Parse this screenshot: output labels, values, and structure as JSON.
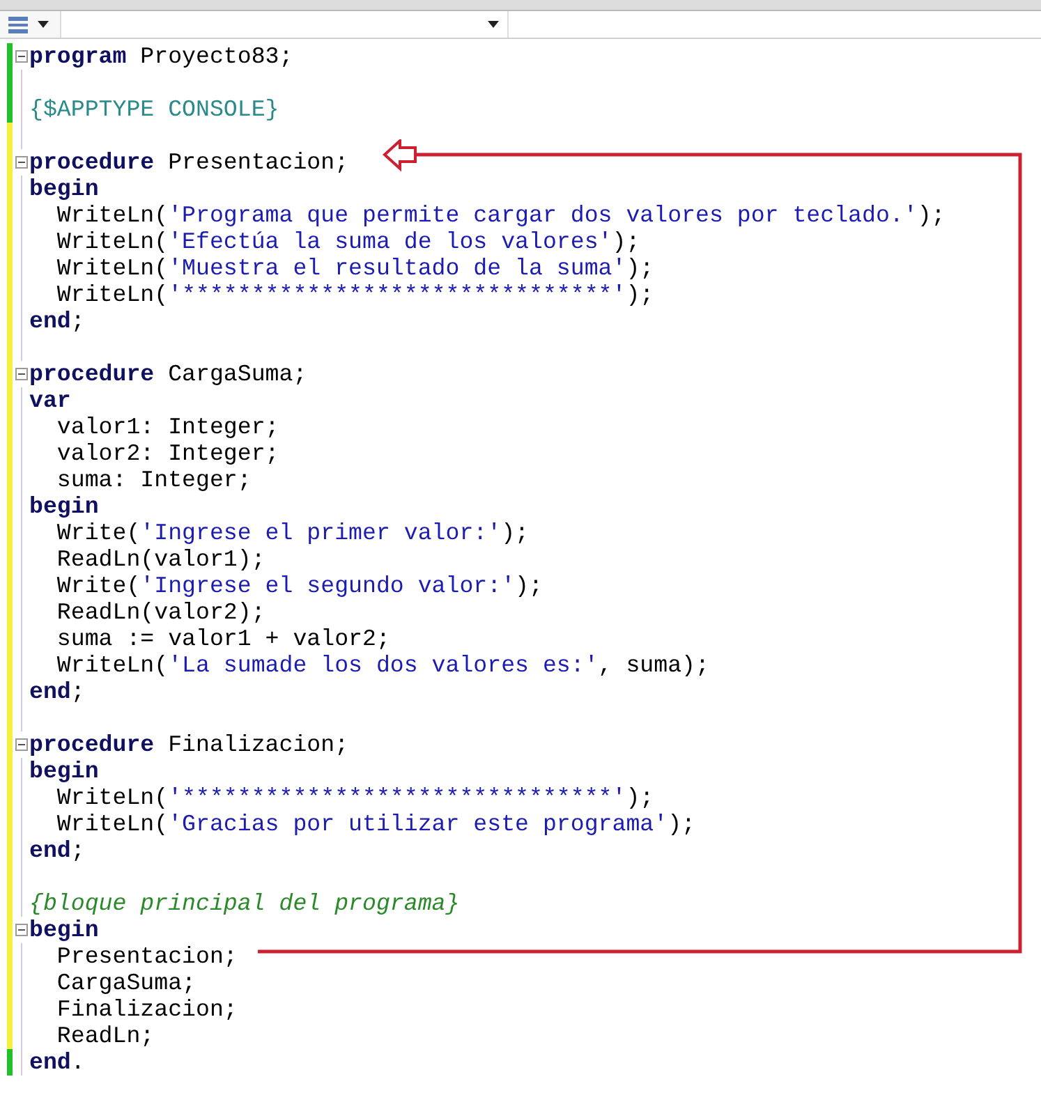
{
  "toolbar": {
    "dropdown": {
      "expanded": false
    }
  },
  "editor": {
    "lines": [
      {
        "saved": true,
        "fold": true,
        "tokens": [
          {
            "kind": "keyword",
            "text": "program"
          },
          {
            "kind": "plain",
            "text": " Proyecto83;"
          }
        ]
      },
      {
        "saved": true,
        "fold": false
      },
      {
        "saved": true,
        "fold": false,
        "tokens": [
          {
            "kind": "directive",
            "text": "{$APPTYPE CONSOLE}"
          }
        ]
      },
      {
        "saved": false,
        "fold": false
      },
      {
        "saved": false,
        "fold": true,
        "tokens": [
          {
            "kind": "keyword",
            "text": "procedure"
          },
          {
            "kind": "plain",
            "text": " Presentacion;"
          }
        ]
      },
      {
        "saved": false,
        "fold": false,
        "tokens": [
          {
            "kind": "keyword",
            "text": "begin"
          }
        ]
      },
      {
        "saved": false,
        "fold": false,
        "tokens": [
          {
            "kind": "plain",
            "text": "  WriteLn("
          },
          {
            "kind": "string",
            "text": "'Programa que permite cargar dos valores por teclado.'"
          },
          {
            "kind": "plain",
            "text": ");"
          }
        ]
      },
      {
        "saved": false,
        "fold": false,
        "tokens": [
          {
            "kind": "plain",
            "text": "  WriteLn("
          },
          {
            "kind": "string",
            "text": "'Efectúa la suma de los valores'"
          },
          {
            "kind": "plain",
            "text": ");"
          }
        ]
      },
      {
        "saved": false,
        "fold": false,
        "tokens": [
          {
            "kind": "plain",
            "text": "  WriteLn("
          },
          {
            "kind": "string",
            "text": "'Muestra el resultado de la suma'"
          },
          {
            "kind": "plain",
            "text": ");"
          }
        ]
      },
      {
        "saved": false,
        "fold": false,
        "tokens": [
          {
            "kind": "plain",
            "text": "  WriteLn("
          },
          {
            "kind": "string",
            "text": "'*******************************'"
          },
          {
            "kind": "plain",
            "text": ");"
          }
        ]
      },
      {
        "saved": false,
        "fold": false,
        "tokens": [
          {
            "kind": "keyword",
            "text": "end"
          },
          {
            "kind": "plain",
            "text": ";"
          }
        ]
      },
      {
        "saved": false,
        "fold": false
      },
      {
        "saved": false,
        "fold": true,
        "tokens": [
          {
            "kind": "keyword",
            "text": "procedure"
          },
          {
            "kind": "plain",
            "text": " CargaSuma;"
          }
        ]
      },
      {
        "saved": false,
        "fold": false,
        "tokens": [
          {
            "kind": "keyword",
            "text": "var"
          }
        ]
      },
      {
        "saved": false,
        "fold": false,
        "tokens": [
          {
            "kind": "plain",
            "text": "  valor1: Integer;"
          }
        ]
      },
      {
        "saved": false,
        "fold": false,
        "tokens": [
          {
            "kind": "plain",
            "text": "  valor2: Integer;"
          }
        ]
      },
      {
        "saved": false,
        "fold": false,
        "tokens": [
          {
            "kind": "plain",
            "text": "  suma: Integer;"
          }
        ]
      },
      {
        "saved": false,
        "fold": false,
        "tokens": [
          {
            "kind": "keyword",
            "text": "begin"
          }
        ]
      },
      {
        "saved": false,
        "fold": false,
        "tokens": [
          {
            "kind": "plain",
            "text": "  Write("
          },
          {
            "kind": "string",
            "text": "'Ingrese el primer valor:'"
          },
          {
            "kind": "plain",
            "text": ");"
          }
        ]
      },
      {
        "saved": false,
        "fold": false,
        "tokens": [
          {
            "kind": "plain",
            "text": "  ReadLn(valor1);"
          }
        ]
      },
      {
        "saved": false,
        "fold": false,
        "tokens": [
          {
            "kind": "plain",
            "text": "  Write("
          },
          {
            "kind": "string",
            "text": "'Ingrese el segundo valor:'"
          },
          {
            "kind": "plain",
            "text": ");"
          }
        ]
      },
      {
        "saved": false,
        "fold": false,
        "tokens": [
          {
            "kind": "plain",
            "text": "  ReadLn(valor2);"
          }
        ]
      },
      {
        "saved": false,
        "fold": false,
        "tokens": [
          {
            "kind": "plain",
            "text": "  suma := valor1 + valor2;"
          }
        ]
      },
      {
        "saved": false,
        "fold": false,
        "tokens": [
          {
            "kind": "plain",
            "text": "  WriteLn("
          },
          {
            "kind": "string",
            "text": "'La sumade los dos valores es:'"
          },
          {
            "kind": "plain",
            "text": ", suma);"
          }
        ]
      },
      {
        "saved": false,
        "fold": false,
        "tokens": [
          {
            "kind": "keyword",
            "text": "end"
          },
          {
            "kind": "plain",
            "text": ";"
          }
        ]
      },
      {
        "saved": false,
        "fold": false
      },
      {
        "saved": false,
        "fold": true,
        "tokens": [
          {
            "kind": "keyword",
            "text": "procedure"
          },
          {
            "kind": "plain",
            "text": " Finalizacion;"
          }
        ]
      },
      {
        "saved": false,
        "fold": false,
        "tokens": [
          {
            "kind": "keyword",
            "text": "begin"
          }
        ]
      },
      {
        "saved": false,
        "fold": false,
        "tokens": [
          {
            "kind": "plain",
            "text": "  WriteLn("
          },
          {
            "kind": "string",
            "text": "'*******************************'"
          },
          {
            "kind": "plain",
            "text": ");"
          }
        ]
      },
      {
        "saved": false,
        "fold": false,
        "tokens": [
          {
            "kind": "plain",
            "text": "  WriteLn("
          },
          {
            "kind": "string",
            "text": "'Gracias por utilizar este programa'"
          },
          {
            "kind": "plain",
            "text": ");"
          }
        ]
      },
      {
        "saved": false,
        "fold": false,
        "tokens": [
          {
            "kind": "keyword",
            "text": "end"
          },
          {
            "kind": "plain",
            "text": ";"
          }
        ]
      },
      {
        "saved": false,
        "fold": false
      },
      {
        "saved": false,
        "fold": false,
        "tokens": [
          {
            "kind": "comment",
            "text": "{bloque principal del programa}"
          }
        ]
      },
      {
        "saved": false,
        "fold": true,
        "tokens": [
          {
            "kind": "keyword",
            "text": "begin"
          }
        ]
      },
      {
        "saved": false,
        "fold": false,
        "tokens": [
          {
            "kind": "plain",
            "text": "  Presentacion;"
          }
        ]
      },
      {
        "saved": false,
        "fold": false,
        "tokens": [
          {
            "kind": "plain",
            "text": "  CargaSuma;"
          }
        ]
      },
      {
        "saved": false,
        "fold": false,
        "tokens": [
          {
            "kind": "plain",
            "text": "  Finalizacion;"
          }
        ]
      },
      {
        "saved": false,
        "fold": false,
        "tokens": [
          {
            "kind": "plain",
            "text": "  ReadLn;"
          }
        ]
      },
      {
        "saved": true,
        "fold": false,
        "tokens": [
          {
            "kind": "keyword",
            "text": "end"
          },
          {
            "kind": "plain",
            "text": "."
          }
        ]
      }
    ]
  }
}
